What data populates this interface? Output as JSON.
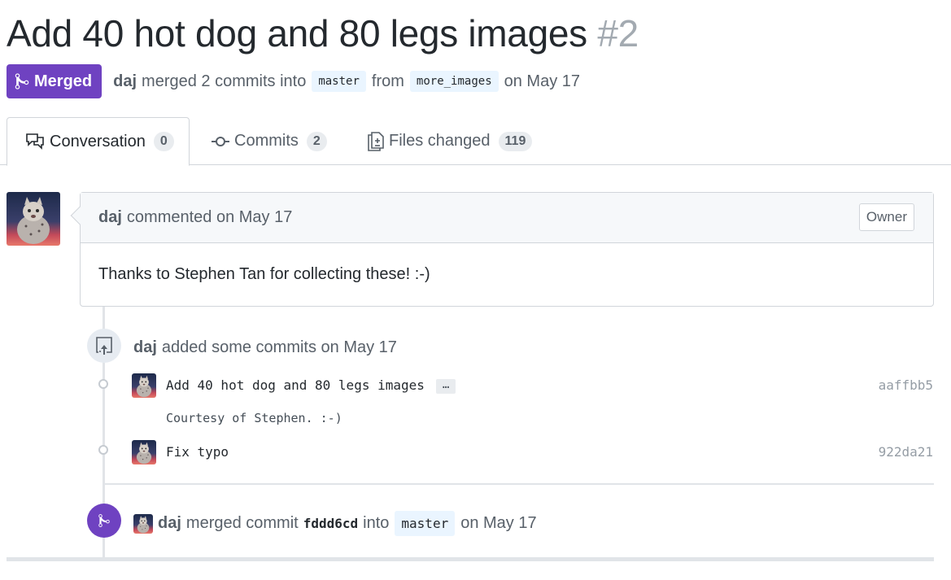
{
  "pr": {
    "title": "Add 40 hot dog and 80 legs images",
    "number": "#2"
  },
  "header": {
    "status_label": "Merged",
    "author": "daj",
    "merged_text": "merged 2 commits into",
    "base_branch": "master",
    "from_text": "from",
    "head_branch": "more_images",
    "date_text": "on May 17"
  },
  "tabs": [
    {
      "label": "Conversation",
      "count": "0",
      "icon": "comment-discussion-icon"
    },
    {
      "label": "Commits",
      "count": "2",
      "icon": "git-commit-icon"
    },
    {
      "label": "Files changed",
      "count": "119",
      "icon": "diff-icon"
    }
  ],
  "comment": {
    "author": "daj",
    "action": "commented on May 17",
    "role_badge": "Owner",
    "body": "Thanks to Stephen Tan for collecting these! :-)"
  },
  "timeline": {
    "commits_event": {
      "author": "daj",
      "action": "added some commits on May 17"
    },
    "commits": [
      {
        "message": "Add 40 hot dog and 80 legs images",
        "ellipsis": "…",
        "sha": "aaffbb5",
        "description": "Courtesy of Stephen. :-)"
      },
      {
        "message": "Fix typo",
        "sha": "922da21"
      }
    ],
    "merge_event": {
      "author": "daj",
      "action": "merged commit",
      "sha": "fddd6cd",
      "into_text": "into",
      "branch": "master",
      "date_text": "on May 17"
    }
  },
  "colors": {
    "merged_purple": "#6f42c1",
    "text_primary": "#24292e",
    "text_secondary": "#586069",
    "border": "#d1d5da"
  }
}
